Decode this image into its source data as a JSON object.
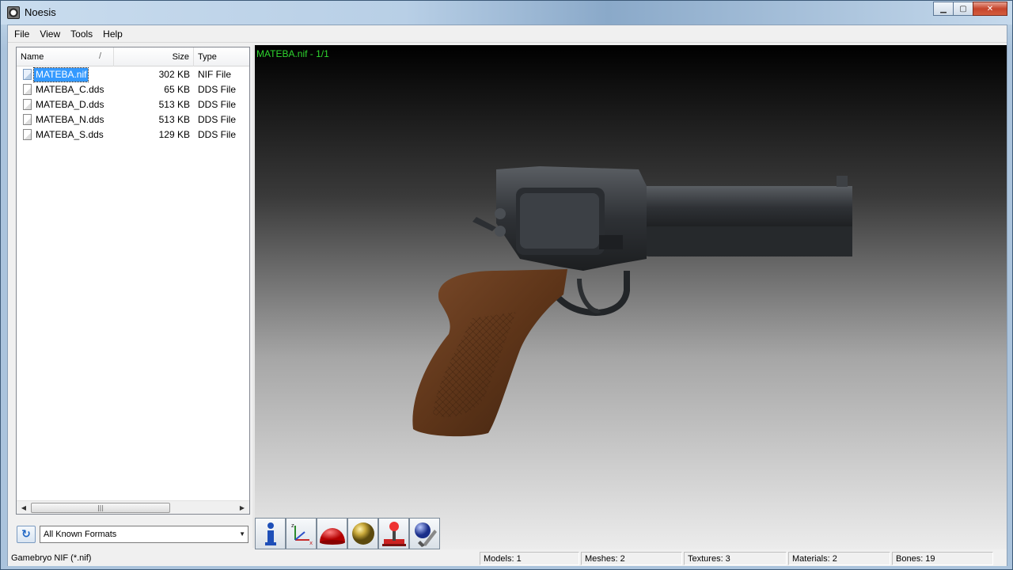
{
  "window": {
    "title": "Noesis",
    "controls": {
      "minimize": "▁",
      "maximize": "▢",
      "close": "✕"
    }
  },
  "menu": [
    "File",
    "View",
    "Tools",
    "Help"
  ],
  "file_list": {
    "columns": {
      "name": "Name",
      "size": "Size",
      "type": "Type",
      "sort_indicator": "/"
    },
    "rows": [
      {
        "name": "MATEBA.nif",
        "size": "302 KB",
        "type": "NIF File",
        "selected": true,
        "icon": "nif-file-icon"
      },
      {
        "name": "MATEBA_C.dds",
        "size": "65 KB",
        "type": "DDS File",
        "selected": false,
        "icon": "dds-file-icon"
      },
      {
        "name": "MATEBA_D.dds",
        "size": "513 KB",
        "type": "DDS File",
        "selected": false,
        "icon": "dds-file-icon"
      },
      {
        "name": "MATEBA_N.dds",
        "size": "513 KB",
        "type": "DDS File",
        "selected": false,
        "icon": "dds-file-icon"
      },
      {
        "name": "MATEBA_S.dds",
        "size": "129 KB",
        "type": "DDS File",
        "selected": false,
        "icon": "dds-file-icon"
      }
    ],
    "scrollbar": {
      "left": "◀",
      "right": "▶",
      "grip": "|||"
    }
  },
  "format_filter": {
    "value": "All Known Formats",
    "refresh_icon": "refresh-icon",
    "dropdown": "▼"
  },
  "viewport": {
    "label": "MATEBA.nif - 1/1",
    "accent": "#2fd62f"
  },
  "toolbar": [
    {
      "name": "info-icon"
    },
    {
      "name": "axes-icon"
    },
    {
      "name": "red-dome-icon"
    },
    {
      "name": "sphere-icon"
    },
    {
      "name": "joystick-icon"
    },
    {
      "name": "globe-brush-icon"
    }
  ],
  "statusbar": {
    "format": "Gamebryo NIF (*.nif)",
    "models": "Models: 1",
    "meshes": "Meshes: 2",
    "textures": "Textures: 3",
    "materials": "Materials: 2",
    "bones": "Bones: 19"
  }
}
